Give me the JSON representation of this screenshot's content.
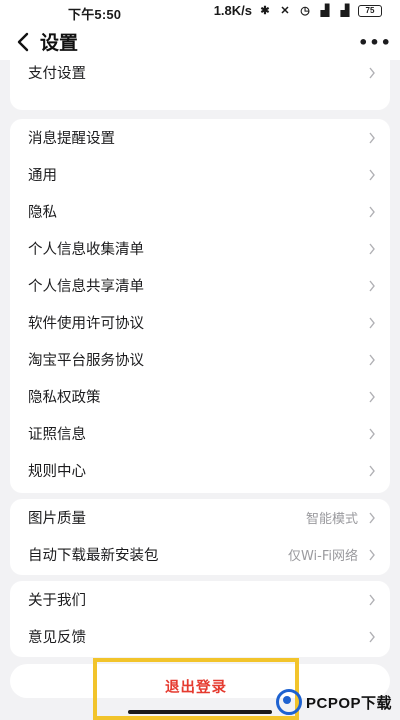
{
  "status_bar": {
    "time": "下午5:50",
    "network_speed": "1.8K/s",
    "battery_level": "75"
  },
  "nav": {
    "title": "设置"
  },
  "groups": [
    {
      "items": [
        {
          "label": "支付设置"
        }
      ]
    },
    {
      "items": [
        {
          "label": "消息提醒设置"
        },
        {
          "label": "通用"
        },
        {
          "label": "隐私"
        },
        {
          "label": "个人信息收集清单"
        },
        {
          "label": "个人信息共享清单"
        },
        {
          "label": "软件使用许可协议"
        },
        {
          "label": "淘宝平台服务协议"
        },
        {
          "label": "隐私权政策"
        },
        {
          "label": "证照信息"
        },
        {
          "label": "规则中心"
        }
      ]
    },
    {
      "items": [
        {
          "label": "图片质量",
          "value": "智能模式"
        },
        {
          "label": "自动下载最新安装包",
          "value": "仅Wi-Fi网络"
        }
      ]
    },
    {
      "items": [
        {
          "label": "关于我们"
        },
        {
          "label": "意见反馈"
        }
      ]
    }
  ],
  "logout": {
    "label": "退出登录"
  },
  "watermark": {
    "text": "PCPOP下载"
  },
  "colors": {
    "background": "#f2f2f4",
    "logout_text": "#e53a2f",
    "highlight_border": "#f2c42b"
  }
}
